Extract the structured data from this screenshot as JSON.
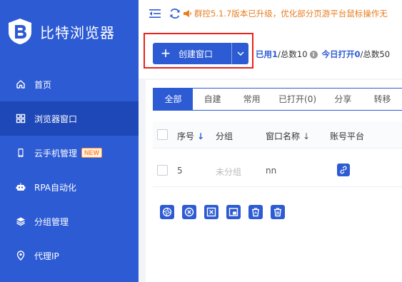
{
  "app": {
    "brand_name": "比特浏览器"
  },
  "sidebar": {
    "items": [
      {
        "label": "首页",
        "icon": "home-icon"
      },
      {
        "label": "浏览器窗口",
        "icon": "grid-icon",
        "active": true
      },
      {
        "label": "云手机管理",
        "icon": "phone-icon",
        "badge": "NEW"
      },
      {
        "label": "RPA自动化",
        "icon": "robot-icon"
      },
      {
        "label": "分组管理",
        "icon": "layers-icon"
      },
      {
        "label": "代理IP",
        "icon": "location-pin-icon"
      }
    ]
  },
  "topbar": {
    "notice": "群控5.1.7版本已升级，优化部分页游平台鼠标操作无"
  },
  "toolbar": {
    "create_label": "创建窗口",
    "used_label": "已用",
    "used_value": "1",
    "total_label": "/总数10",
    "today_label": "今日打开",
    "today_value": "0",
    "today_total_label": "/总数50"
  },
  "tabs": [
    {
      "label": "全部",
      "active": true
    },
    {
      "label": "自建"
    },
    {
      "label": "常用"
    },
    {
      "label": "已打开(0)"
    },
    {
      "label": "分享"
    },
    {
      "label": "转移"
    }
  ],
  "table": {
    "headers": {
      "seq": "序号",
      "group": "分组",
      "name": "窗口名称",
      "platform": "账号平台"
    },
    "sort_arrow": "↓",
    "rows": [
      {
        "seq": "5",
        "group": "未分组",
        "name": "nn"
      }
    ]
  },
  "bulk_actions": [
    {
      "icon": "aperture-icon"
    },
    {
      "icon": "close-circle-icon"
    },
    {
      "icon": "close-square-icon"
    },
    {
      "icon": "window-icon"
    },
    {
      "icon": "recycle-trash-icon"
    },
    {
      "icon": "trash-icon"
    }
  ],
  "colors": {
    "primary": "#2d5bd4",
    "sidebar_active": "#1e48b8",
    "highlight": "#e8221d",
    "notice": "#e67e22"
  }
}
